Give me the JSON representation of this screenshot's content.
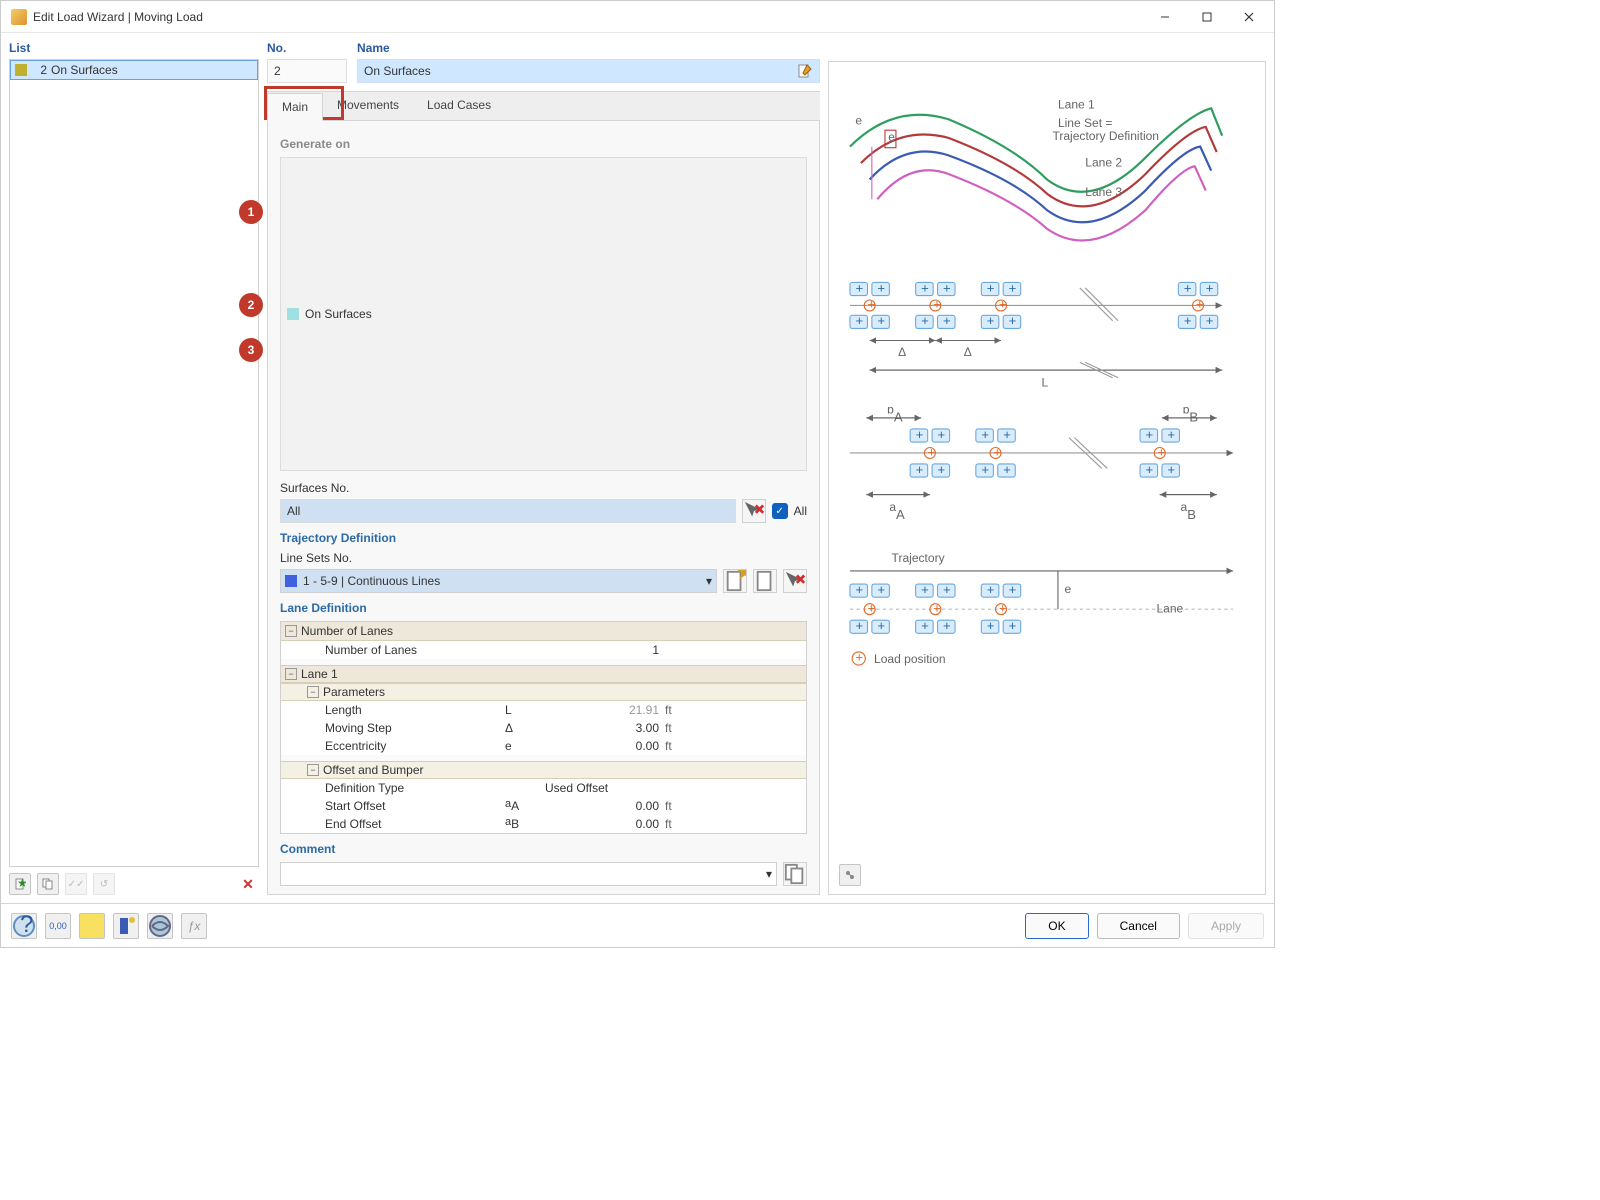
{
  "window": {
    "title": "Edit Load Wizard | Moving Load"
  },
  "list": {
    "label": "List",
    "items": [
      {
        "index": "2",
        "name": "On Surfaces"
      }
    ]
  },
  "header": {
    "no_label": "No.",
    "no_value": "2",
    "name_label": "Name",
    "name_value": "On Surfaces"
  },
  "tabs": {
    "main": "Main",
    "movements": "Movements",
    "load_cases": "Load Cases",
    "active": "main"
  },
  "main": {
    "generate_on": {
      "title": "Generate on",
      "value": "On Surfaces",
      "surfaces_label": "Surfaces No.",
      "surfaces_value": "All",
      "all_checked": true,
      "all_label": "All"
    },
    "trajectory": {
      "title": "Trajectory Definition",
      "linesets_label": "Line Sets No.",
      "linesets_value": "1 - 5-9 | Continuous Lines"
    },
    "lane_def": {
      "title": "Lane Definition",
      "number_of_lanes_header": "Number of Lanes",
      "number_of_lanes_label": "Number of Lanes",
      "number_of_lanes_value": "1",
      "lane1_label": "Lane 1",
      "params_label": "Parameters",
      "rows": {
        "length": {
          "label": "Length",
          "sym": "L",
          "val": "21.91",
          "unit": "ft"
        },
        "moving_step": {
          "label": "Moving Step",
          "sym": "Δ",
          "val": "3.00",
          "unit": "ft"
        },
        "eccentricity": {
          "label": "Eccentricity",
          "sym": "e",
          "val": "0.00",
          "unit": "ft"
        }
      },
      "offset_label": "Offset and Bumper",
      "offset_rows": {
        "def_type": {
          "label": "Definition Type",
          "sym": "",
          "val": "Used Offset",
          "unit": ""
        },
        "start_offset": {
          "label": "Start Offset",
          "sym": "aA",
          "val": "0.00",
          "unit": "ft"
        },
        "end_offset": {
          "label": "End Offset",
          "sym": "aB",
          "val": "0.00",
          "unit": "ft"
        }
      }
    },
    "comment_label": "Comment",
    "comment_value": ""
  },
  "diagram": {
    "lane1": "Lane 1",
    "lineset": "Line Set =",
    "traj_def": "Trajectory Definition",
    "lane2": "Lane 2",
    "lane3": "Lane 3",
    "e": "e",
    "delta": "Δ",
    "L": "L",
    "bA": "bA",
    "bB": "bB",
    "aA": "aA",
    "aB": "aB",
    "traj": "Trajectory",
    "lane": "Lane",
    "load_pos": "Load position"
  },
  "footer": {
    "ok": "OK",
    "cancel": "Cancel",
    "apply": "Apply"
  },
  "callouts": {
    "c1": "1",
    "c2": "2",
    "c3": "3"
  }
}
